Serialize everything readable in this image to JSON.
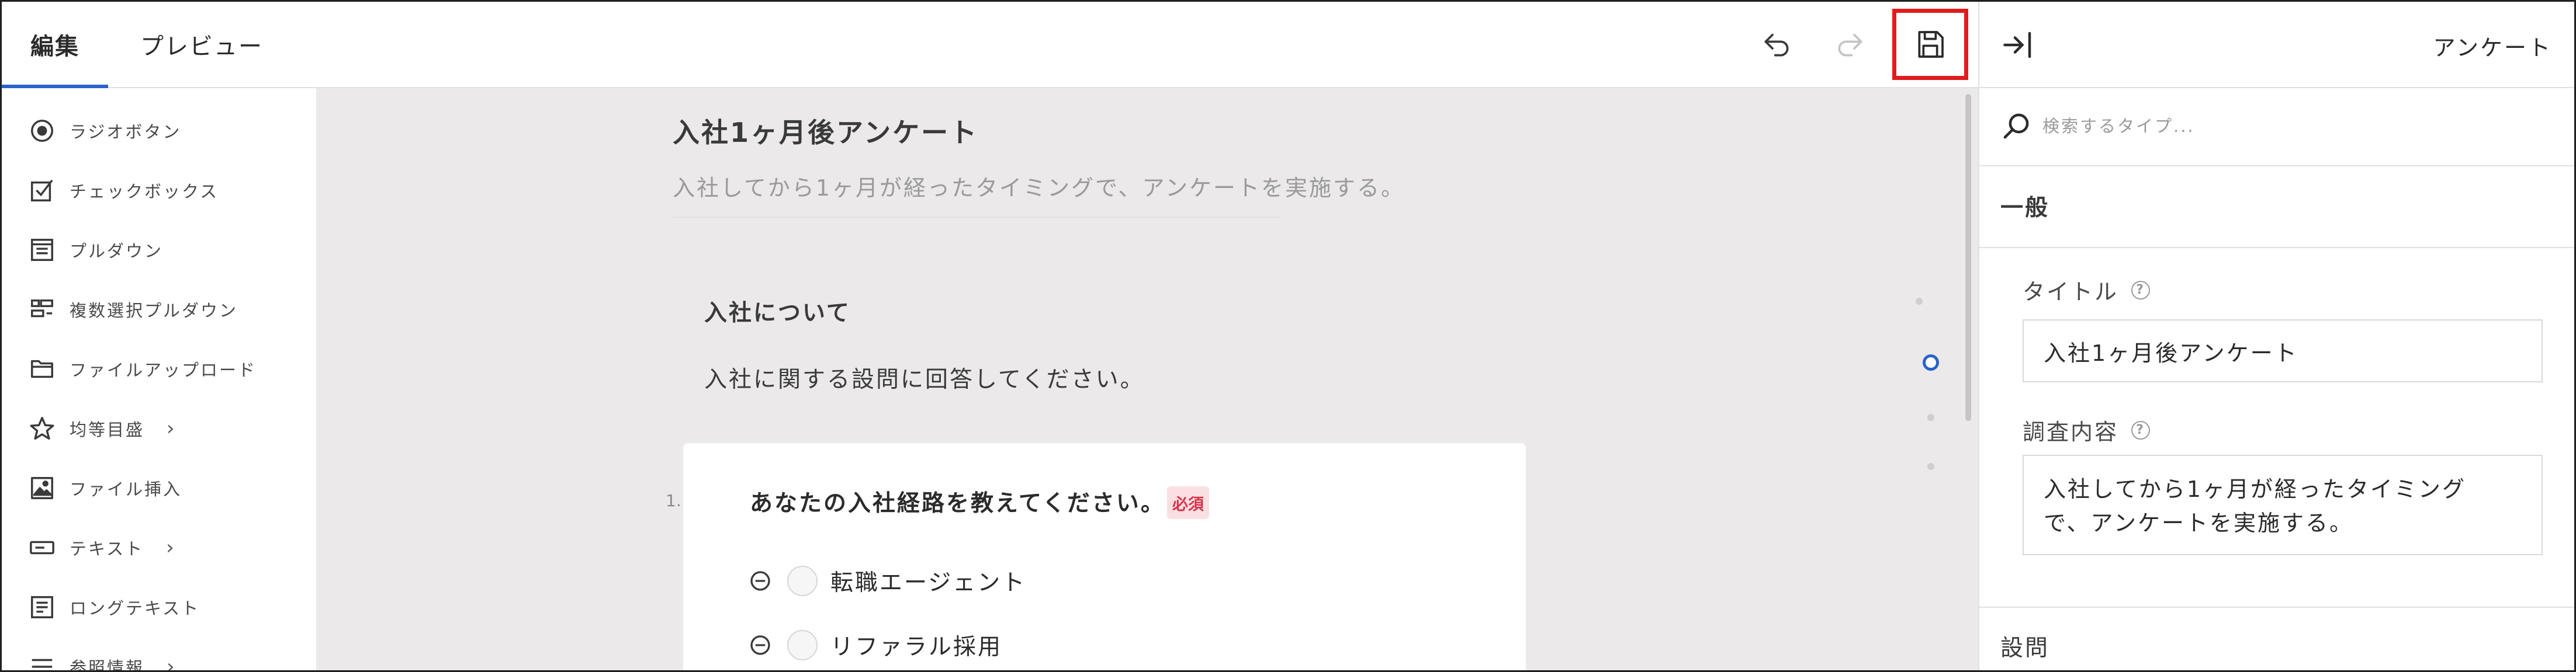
{
  "topbar": {
    "tabs": [
      {
        "label": "編集",
        "active": true
      },
      {
        "label": "プレビュー",
        "active": false
      }
    ],
    "actions": {
      "undo_icon": "undo-icon",
      "redo_icon": "redo-icon",
      "save_icon": "save-icon"
    },
    "highlight_color": "#e01c1c"
  },
  "palette": {
    "items": [
      {
        "label": "ラジオボタン",
        "icon": "radio-button-icon",
        "submenu": false
      },
      {
        "label": "チェックボックス",
        "icon": "checkbox-icon",
        "submenu": false
      },
      {
        "label": "プルダウン",
        "icon": "dropdown-icon",
        "submenu": false
      },
      {
        "label": "複数選択プルダウン",
        "icon": "multi-select-icon",
        "submenu": false
      },
      {
        "label": "ファイルアップロード",
        "icon": "folder-icon",
        "submenu": false
      },
      {
        "label": "均等目盛",
        "icon": "star-icon",
        "submenu": true
      },
      {
        "label": "ファイル挿入",
        "icon": "image-icon",
        "submenu": false
      },
      {
        "label": "テキスト",
        "icon": "text-field-icon",
        "submenu": true
      },
      {
        "label": "ロングテキスト",
        "icon": "long-text-icon",
        "submenu": false
      },
      {
        "label": "参照情報",
        "icon": "list-icon",
        "submenu": true
      }
    ]
  },
  "canvas": {
    "survey_title": "入社1ヶ月後アンケート",
    "survey_description": "入社してから1ヶ月が経ったタイミングで、アンケートを実施する。",
    "section": {
      "title": "入社について",
      "description": "入社に関する設問に回答してください。"
    },
    "question": {
      "number": "1.",
      "text": "あなたの入社経路を教えてください。",
      "required_badge": "必須",
      "options": [
        "転職エージェント",
        "リファラル採用"
      ]
    },
    "accent_color": "#2a63c9"
  },
  "right_panel": {
    "title": "アンケート",
    "search_placeholder": "検索するタイプ...",
    "general_label": "一般",
    "title_field_label": "タイトル",
    "title_field_value": "入社1ヶ月後アンケート",
    "content_field_label": "調査内容",
    "content_field_value": "入社してから1ヶ月が経ったタイミング\nで、アンケートを実施する。",
    "questions_label": "設問"
  }
}
